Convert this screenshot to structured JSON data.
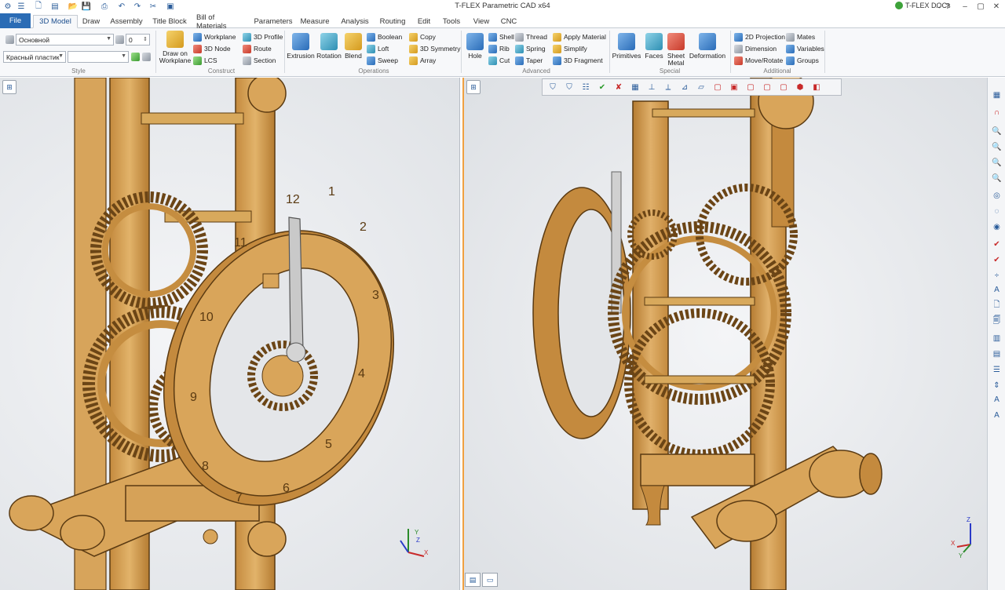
{
  "title_bar": {
    "app_title": "T-FLEX Parametric CAD x64",
    "docs_label": "T-FLEX DOCs",
    "icons": [
      "app-menu-icon",
      "menu-icon",
      "new-file-icon",
      "open-file-icon",
      "save-icon",
      "save-all-icon",
      "print-icon",
      "undo-icon",
      "redo-icon",
      "cut-icon",
      "copy-icon",
      "paste-icon",
      "document-icon"
    ]
  },
  "tabs": {
    "file": "File",
    "items": [
      "3D Model",
      "Draw",
      "Assembly",
      "Title Block",
      "Bill of Materials",
      "Parameters",
      "Measure",
      "Analysis",
      "Routing",
      "Edit",
      "Tools",
      "View",
      "CNC"
    ]
  },
  "ribbon": {
    "style": {
      "label": "Style",
      "layer_value": "Основной",
      "level_value": "0",
      "material_value": "Красный пластик",
      "color_value": ""
    },
    "construct": {
      "label": "Construct",
      "draw_on_workplane": [
        "Draw on",
        "Workplane"
      ],
      "workplane": "Workplane",
      "node": "3D Node",
      "lcs": "LCS",
      "profile": "3D Profile",
      "route": "Route",
      "section": "Section"
    },
    "operations": {
      "label": "Operations",
      "extrusion": "Extrusion",
      "rotation": "Rotation",
      "blend": "Blend",
      "boolean": "Boolean",
      "loft": "Loft",
      "sweep": "Sweep",
      "copy": "Copy",
      "symmetry": "3D Symmetry",
      "array": "Array"
    },
    "advanced": {
      "label": "Advanced",
      "hole": "Hole",
      "shell": "Shell",
      "rib": "Rib",
      "cut": "Cut",
      "thread": "Thread",
      "spring": "Spring",
      "taper": "Taper",
      "apply_material": "Apply Material",
      "simplify": "Simplify",
      "fragment": "3D Fragment"
    },
    "special": {
      "label": "Special",
      "primitives": "Primitives",
      "faces": "Faces",
      "sheet_metal": [
        "Sheet",
        "Metal"
      ],
      "deformation": "Deformation"
    },
    "additional": {
      "label": "Additional",
      "projection": "2D Projection",
      "dimension": "Dimension",
      "move_rotate": "Move/Rotate",
      "mates": "Mates",
      "variables": "Variables",
      "groups": "Groups"
    }
  },
  "viewport": {
    "clock_numerals": [
      "12",
      "1",
      "2",
      "3",
      "4",
      "5",
      "6",
      "7",
      "8",
      "9",
      "10",
      "11"
    ],
    "axis_labels": {
      "x": "X",
      "y": "Y",
      "z": "Z"
    }
  },
  "colors": {
    "accent": "#2b6cb5",
    "wood": "#d9a55a",
    "wood_dark": "#8a5a1e",
    "active_view_border": "#f0a040"
  }
}
